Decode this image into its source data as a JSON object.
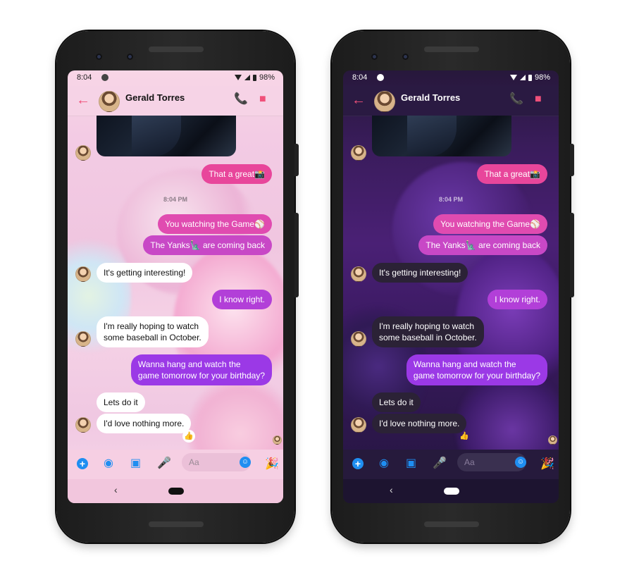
{
  "status": {
    "time": "8:04",
    "battery": "98%"
  },
  "conversation": {
    "contact_name": "Gerald Torres"
  },
  "messages": {
    "m1": "That a great📸",
    "timestamp": "8:04 PM",
    "m2": "You watching the Game⚾",
    "m3": "The Yanks🗽 are coming back",
    "m4": "It's getting interesting!",
    "m5": "I know right.",
    "m6": "I'm really hoping to watch\nsome baseball in October.",
    "m7": "Wanna hang and watch the\ngame tomorrow for your birthday?",
    "m8": "Lets do it",
    "m9": "I'd love nothing more.",
    "reaction": "👍"
  },
  "composer": {
    "placeholder": "Aa",
    "emoji": "☺",
    "party": "🎉"
  },
  "nav": {
    "back": "‹"
  },
  "icons": {
    "back": "←",
    "phone": "📞",
    "video": "■",
    "plus": "+",
    "camera": "◉",
    "gallery": "▣",
    "mic": "🎤"
  },
  "colors": {
    "accent": "#f0507a",
    "out_pink": "#e8469b",
    "out_purple": "#9b39e6",
    "composer_blue": "#1f8ef1"
  }
}
